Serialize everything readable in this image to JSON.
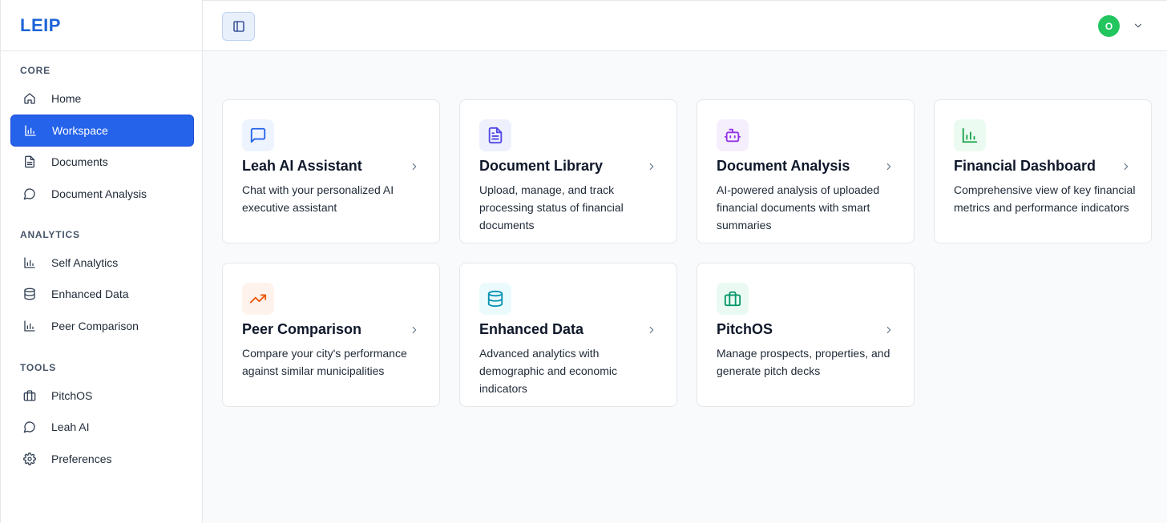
{
  "brand": {
    "name": "LEIP"
  },
  "sidebar": {
    "sections": [
      {
        "title": "CORE",
        "items": [
          {
            "label": "Home",
            "icon": "home-icon"
          },
          {
            "label": "Workspace",
            "icon": "bar-chart-icon",
            "active": true
          },
          {
            "label": "Documents",
            "icon": "file-text-icon"
          },
          {
            "label": "Document Analysis",
            "icon": "message-circle-icon"
          }
        ]
      },
      {
        "title": "ANALYTICS",
        "items": [
          {
            "label": "Self Analytics",
            "icon": "bar-chart-icon"
          },
          {
            "label": "Enhanced Data",
            "icon": "database-icon"
          },
          {
            "label": "Peer Comparison",
            "icon": "bar-chart-icon"
          }
        ]
      },
      {
        "title": "TOOLS",
        "items": [
          {
            "label": "PitchOS",
            "icon": "briefcase-icon"
          },
          {
            "label": "Leah AI",
            "icon": "message-circle-icon"
          },
          {
            "label": "Preferences",
            "icon": "gear-icon"
          }
        ]
      }
    ]
  },
  "header": {
    "toggle_icon": "sidebar-toggle-icon",
    "user_initial": "O",
    "user_avatar_color": "#22c55e"
  },
  "colors": {
    "accent": "#2563eb",
    "brand": "#1d64d8"
  },
  "cards": [
    {
      "title": "Leah AI Assistant",
      "description": "Chat with your personalized AI executive assistant",
      "icon": "message-square-icon",
      "icon_color": "#2563eb",
      "icon_bg": "#eef4fe"
    },
    {
      "title": "Document Library",
      "description": "Upload, manage, and track processing status of financial documents",
      "icon": "file-text-icon",
      "icon_color": "#4f46e5",
      "icon_bg": "#eef0fd"
    },
    {
      "title": "Document Analysis",
      "description": "AI-powered analysis of uploaded financial documents with smart summaries",
      "icon": "bot-icon",
      "icon_color": "#9333ea",
      "icon_bg": "#f5effd"
    },
    {
      "title": "Financial Dashboard",
      "description": "Comprehensive view of key financial metrics and performance indicators",
      "icon": "bar-chart-icon",
      "icon_color": "#16a34a",
      "icon_bg": "#ecfbf1"
    },
    {
      "title": "Peer Comparison",
      "description": "Compare your city's performance against similar municipalities",
      "icon": "trending-up-icon",
      "icon_color": "#ea580c",
      "icon_bg": "#fef3ec"
    },
    {
      "title": "Enhanced Data",
      "description": "Advanced analytics with demographic and economic indicators",
      "icon": "database-icon",
      "icon_color": "#0891b2",
      "icon_bg": "#ebfbfd"
    },
    {
      "title": "PitchOS",
      "description": "Manage prospects, properties, and generate pitch decks",
      "icon": "briefcase-icon",
      "icon_color": "#059669",
      "icon_bg": "#eafaf3"
    }
  ]
}
